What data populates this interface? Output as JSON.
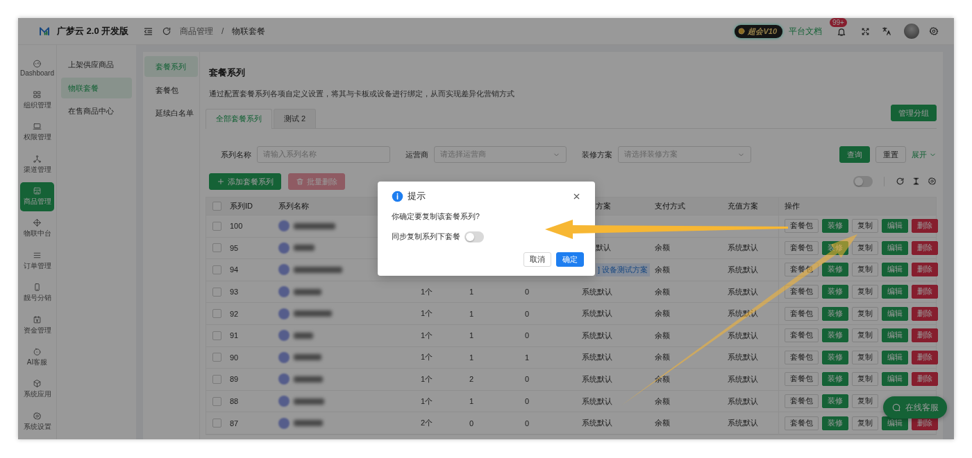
{
  "app": {
    "title": "广梦云 2.0 开发版"
  },
  "header": {
    "breadcrumb": [
      "商品管理",
      "物联套餐"
    ],
    "breadcrumb_separator": "/",
    "member_badge": "超会V10",
    "docs_link": "平台文档",
    "notification_count": "99+"
  },
  "rail": [
    {
      "label": "Dashboard",
      "selected": false
    },
    {
      "label": "组织管理",
      "selected": false
    },
    {
      "label": "权限管理",
      "selected": false
    },
    {
      "label": "渠道管理",
      "selected": false
    },
    {
      "label": "商品管理",
      "selected": true
    },
    {
      "label": "物联中台",
      "selected": false
    },
    {
      "label": "订单管理",
      "selected": false
    },
    {
      "label": "靓号分销",
      "selected": false
    },
    {
      "label": "资金管理",
      "selected": false
    },
    {
      "label": "AI客服",
      "selected": false
    },
    {
      "label": "系统应用",
      "selected": false
    },
    {
      "label": "系统设置",
      "selected": false
    }
  ],
  "submenu": [
    {
      "label": "上架供应商品",
      "selected": false
    },
    {
      "label": "物联套餐",
      "selected": true
    },
    {
      "label": "在售商品中心",
      "selected": false
    }
  ],
  "inner_nav": [
    {
      "label": "套餐系列",
      "selected": true
    },
    {
      "label": "套餐包",
      "selected": false
    },
    {
      "label": "延续白名单",
      "selected": false
    }
  ],
  "page": {
    "title": "套餐系列",
    "description": "通过配置套餐系列各项自定义设置，将其与卡板或设备进行绑定，从而实现差异化营销方式",
    "manage_button": "管理分组",
    "tabs": [
      {
        "label": "全部套餐系列",
        "selected": true
      },
      {
        "label": "测试 2",
        "selected": false
      }
    ]
  },
  "filters": [
    {
      "kind": "input",
      "label": "系列名称",
      "placeholder": "请输入系列名称"
    },
    {
      "kind": "select",
      "label": "运营商",
      "placeholder": "请选择运营商"
    },
    {
      "kind": "select",
      "label": "装修方案",
      "placeholder": "请选择装修方案"
    }
  ],
  "filter_buttons": {
    "query": "查询",
    "reset": "重置",
    "expand": "展开"
  },
  "toolbar": {
    "add_button": "添加套餐系列",
    "batch_delete": {
      "label": "批量删除",
      "disabled": true
    },
    "switch": {
      "on": false
    }
  },
  "table": {
    "columns": [
      "系列ID",
      "系列名称",
      null,
      null,
      null,
      "方案",
      "支付方式",
      "充值方案",
      "操作"
    ],
    "all_selected": false,
    "rows": [
      {
        "selected": false,
        "id": "100",
        "actions": [
          {
            "label": "套餐包",
            "kind": "default"
          },
          {
            "label": "装修",
            "kind": "primary"
          },
          {
            "label": "复制",
            "kind": "default"
          },
          {
            "label": "编辑",
            "kind": "primary"
          },
          {
            "label": "删除",
            "kind": "danger"
          }
        ]
      },
      {
        "selected": false,
        "id": "95",
        "decoration": {
          "kind": "text",
          "text": "默认"
        },
        "payment": "余额",
        "recharge": "系统默认",
        "actions": [
          {
            "label": "套餐包",
            "kind": "default"
          },
          {
            "label": "装修",
            "kind": "primary"
          },
          {
            "label": "复制",
            "kind": "default"
          },
          {
            "label": "编辑",
            "kind": "primary"
          },
          {
            "label": "删除",
            "kind": "danger"
          }
        ]
      },
      {
        "selected": false,
        "id": "94",
        "decoration": {
          "kind": "tag",
          "text": "] 设备测试方案"
        },
        "payment": "余额",
        "recharge": "系统默认",
        "actions": [
          {
            "label": "套餐包",
            "kind": "default"
          },
          {
            "label": "装修",
            "kind": "primary"
          },
          {
            "label": "复制",
            "kind": "default"
          },
          {
            "label": "编辑",
            "kind": "primary"
          },
          {
            "label": "删除",
            "kind": "danger"
          }
        ]
      },
      {
        "selected": false,
        "id": "93",
        "column_3": "1个",
        "column_4": "1",
        "column_5": "0",
        "decoration": {
          "kind": "text",
          "text": "系统默认"
        },
        "payment": "余额",
        "recharge": "系统默认",
        "actions": [
          {
            "label": "套餐包",
            "kind": "default"
          },
          {
            "label": "装修",
            "kind": "primary"
          },
          {
            "label": "复制",
            "kind": "default"
          },
          {
            "label": "编辑",
            "kind": "primary"
          },
          {
            "label": "删除",
            "kind": "danger"
          }
        ]
      },
      {
        "selected": false,
        "id": "92",
        "column_3": "1个",
        "column_4": "1",
        "column_5": "0",
        "decoration": {
          "kind": "text",
          "text": "系统默认"
        },
        "payment": "余额",
        "recharge": "系统默认",
        "actions": [
          {
            "label": "套餐包",
            "kind": "default"
          },
          {
            "label": "装修",
            "kind": "primary"
          },
          {
            "label": "复制",
            "kind": "default"
          },
          {
            "label": "编辑",
            "kind": "primary"
          },
          {
            "label": "删除",
            "kind": "danger"
          }
        ]
      },
      {
        "selected": false,
        "id": "91",
        "column_3": "1个",
        "column_4": "1",
        "column_5": "0",
        "decoration": {
          "kind": "text",
          "text": "系统默认"
        },
        "payment": "余额",
        "recharge": "系统默认",
        "actions": [
          {
            "label": "套餐包",
            "kind": "default"
          },
          {
            "label": "装修",
            "kind": "primary"
          },
          {
            "label": "复制",
            "kind": "default"
          },
          {
            "label": "编辑",
            "kind": "primary"
          },
          {
            "label": "删除",
            "kind": "danger"
          }
        ]
      },
      {
        "selected": false,
        "id": "90",
        "column_3": "1个",
        "column_4": "1",
        "column_5": "1",
        "decoration": {
          "kind": "text",
          "text": "系统默认"
        },
        "payment": "余额",
        "recharge": "系统默认",
        "actions": [
          {
            "label": "套餐包",
            "kind": "default"
          },
          {
            "label": "装修",
            "kind": "primary"
          },
          {
            "label": "复制",
            "kind": "default"
          },
          {
            "label": "编辑",
            "kind": "primary"
          },
          {
            "label": "删除",
            "kind": "danger"
          }
        ]
      },
      {
        "selected": false,
        "id": "89",
        "column_3": "1个",
        "column_4": "2",
        "column_5": "0",
        "decoration": {
          "kind": "text",
          "text": "系统默认"
        },
        "payment": "余额",
        "recharge": "系统默认",
        "actions": [
          {
            "label": "套餐包",
            "kind": "default"
          },
          {
            "label": "装修",
            "kind": "primary"
          },
          {
            "label": "复制",
            "kind": "default"
          },
          {
            "label": "编辑",
            "kind": "primary"
          },
          {
            "label": "删除",
            "kind": "danger"
          }
        ]
      },
      {
        "selected": false,
        "id": "88",
        "column_3": "1个",
        "column_4": "1",
        "column_5": "0",
        "decoration": {
          "kind": "text",
          "text": "系统默认"
        },
        "payment": "余额",
        "recharge": "系统默认",
        "actions": [
          {
            "label": "套餐包",
            "kind": "default"
          },
          {
            "label": "装修",
            "kind": "primary"
          },
          {
            "label": "复制",
            "kind": "default"
          }
        ]
      },
      {
        "selected": false,
        "id": "87",
        "column_3": "2个",
        "column_4": "0",
        "column_5": "0",
        "decoration": {
          "kind": "text",
          "text": "系统默认"
        },
        "payment": "余额",
        "recharge": "系统默认",
        "actions": [
          {
            "label": "套餐包",
            "kind": "default"
          },
          {
            "label": "装修",
            "kind": "primary"
          },
          {
            "label": "复制",
            "kind": "default"
          },
          {
            "label": "编辑",
            "kind": "primary"
          },
          {
            "label": "删除",
            "kind": "danger"
          }
        ]
      }
    ]
  },
  "dialog": {
    "title": "提示",
    "message": "你确定要复制该套餐系列?",
    "option_label": "同步复制系列下套餐",
    "option_on": false,
    "cancel": "取消",
    "confirm": "确定"
  },
  "chat_button": "在线客服"
}
